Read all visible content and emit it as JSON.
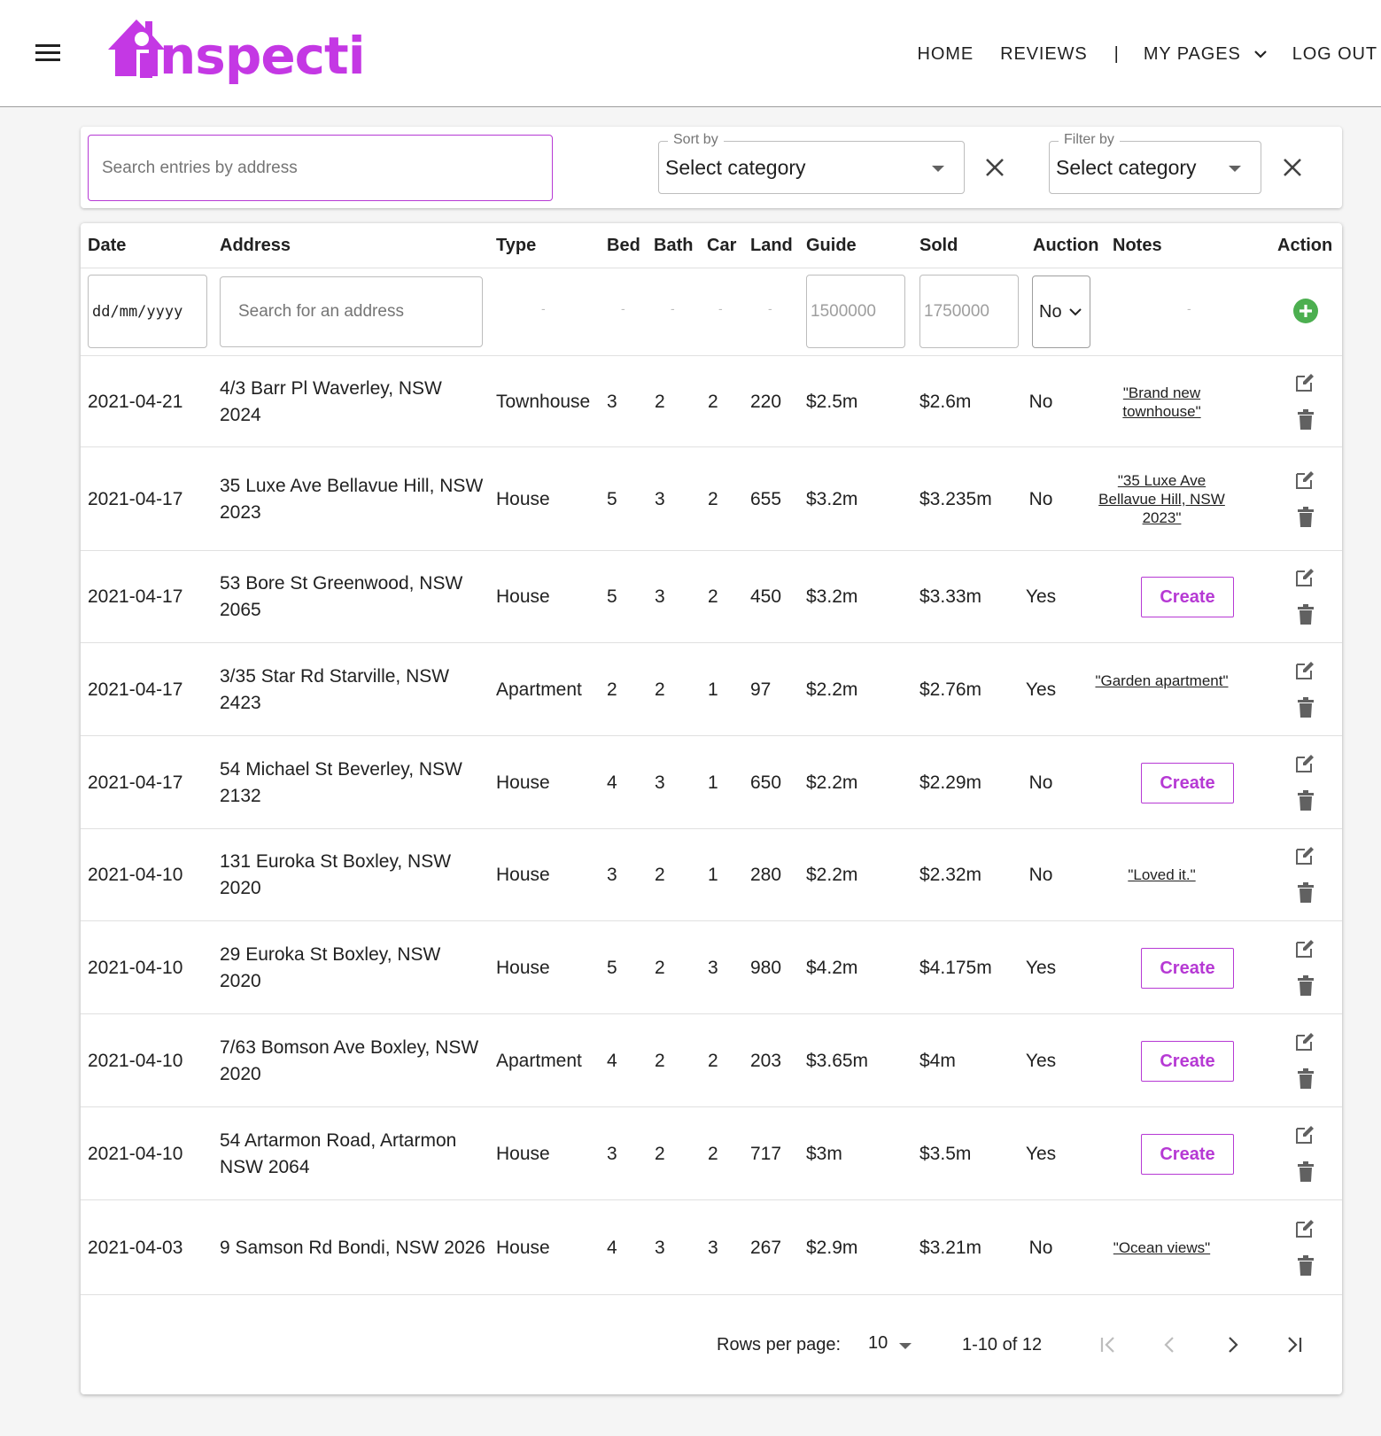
{
  "header": {
    "logo_text": "nspecti",
    "nav": {
      "home": "HOME",
      "reviews": "REVIEWS",
      "separator": "|",
      "my_pages": "MY PAGES",
      "logout": "LOG OUT"
    }
  },
  "filters": {
    "search_placeholder": "Search entries by address",
    "sort": {
      "legend": "Sort by",
      "value": "Select category"
    },
    "filter": {
      "legend": "Filter by",
      "value": "Select category"
    }
  },
  "table": {
    "headers": {
      "date": "Date",
      "address": "Address",
      "type": "Type",
      "bed": "Bed",
      "bath": "Bath",
      "car": "Car",
      "land": "Land",
      "guide": "Guide",
      "sold": "Sold",
      "auction": "Auction",
      "notes": "Notes",
      "action": "Action"
    },
    "new_entry": {
      "date_placeholder": "dd/mm/yyyy",
      "address_placeholder": "Search for an address",
      "empty_dash": "-",
      "guide_value": "1500000",
      "sold_value": "1750000",
      "auction_value": "No"
    },
    "create_label": "Create",
    "rows": [
      {
        "date": "2021-04-21",
        "address": "4/3 Barr Pl Waverley, NSW 2024",
        "type": "Townhouse",
        "bed": "3",
        "bath": "2",
        "car": "2",
        "land": "220",
        "guide": "$2.5m",
        "sold": "$2.6m",
        "auction": "No",
        "note": "\"Brand new townhouse\""
      },
      {
        "date": "2021-04-17",
        "address": "35 Luxe Ave Bellavue Hill, NSW 2023",
        "type": "House",
        "bed": "5",
        "bath": "3",
        "car": "2",
        "land": "655",
        "guide": "$3.2m",
        "sold": "$3.235m",
        "auction": "No",
        "note": "\"35 Luxe Ave Bellavue Hill, NSW 2023\""
      },
      {
        "date": "2021-04-17",
        "address": "53 Bore St Greenwood, NSW 2065",
        "type": "House",
        "bed": "5",
        "bath": "3",
        "car": "2",
        "land": "450",
        "guide": "$3.2m",
        "sold": "$3.33m",
        "auction": "Yes",
        "note": ""
      },
      {
        "date": "2021-04-17",
        "address": "3/35 Star Rd Starville, NSW 2423",
        "type": "Apartment",
        "bed": "2",
        "bath": "2",
        "car": "1",
        "land": "97",
        "guide": "$2.2m",
        "sold": "$2.76m",
        "auction": "Yes",
        "note": "\"Garden apartment\""
      },
      {
        "date": "2021-04-17",
        "address": "54 Michael St Beverley, NSW 2132",
        "type": "House",
        "bed": "4",
        "bath": "3",
        "car": "1",
        "land": "650",
        "guide": "$2.2m",
        "sold": "$2.29m",
        "auction": "No",
        "note": ""
      },
      {
        "date": "2021-04-10",
        "address": "131 Euroka St Boxley, NSW 2020",
        "type": "House",
        "bed": "3",
        "bath": "2",
        "car": "1",
        "land": "280",
        "guide": "$2.2m",
        "sold": "$2.32m",
        "auction": "No",
        "note": "\"Loved it.\""
      },
      {
        "date": "2021-04-10",
        "address": "29 Euroka St Boxley, NSW 2020",
        "type": "House",
        "bed": "5",
        "bath": "2",
        "car": "3",
        "land": "980",
        "guide": "$4.2m",
        "sold": "$4.175m",
        "auction": "Yes",
        "note": ""
      },
      {
        "date": "2021-04-10",
        "address": "7/63 Bomson Ave Boxley, NSW 2020",
        "type": "Apartment",
        "bed": "4",
        "bath": "2",
        "car": "2",
        "land": "203",
        "guide": "$3.65m",
        "sold": "$4m",
        "auction": "Yes",
        "note": ""
      },
      {
        "date": "2021-04-10",
        "address": "54 Artarmon Road, Artarmon NSW 2064",
        "type": "House",
        "bed": "3",
        "bath": "2",
        "car": "2",
        "land": "717",
        "guide": "$3m",
        "sold": "$3.5m",
        "auction": "Yes",
        "note": ""
      },
      {
        "date": "2021-04-03",
        "address": "9 Samson Rd Bondi, NSW 2026",
        "type": "House",
        "bed": "4",
        "bath": "3",
        "car": "3",
        "land": "267",
        "guide": "$2.9m",
        "sold": "$3.21m",
        "auction": "No",
        "note": "\"Ocean views\""
      }
    ]
  },
  "pagination": {
    "rows_per_page_label": "Rows per page:",
    "rows_per_page": "10",
    "range": "1-10 of 12"
  },
  "colors": {
    "brand": "#c438e4",
    "accent": "#b639d4",
    "add_green": "#4caf50"
  }
}
